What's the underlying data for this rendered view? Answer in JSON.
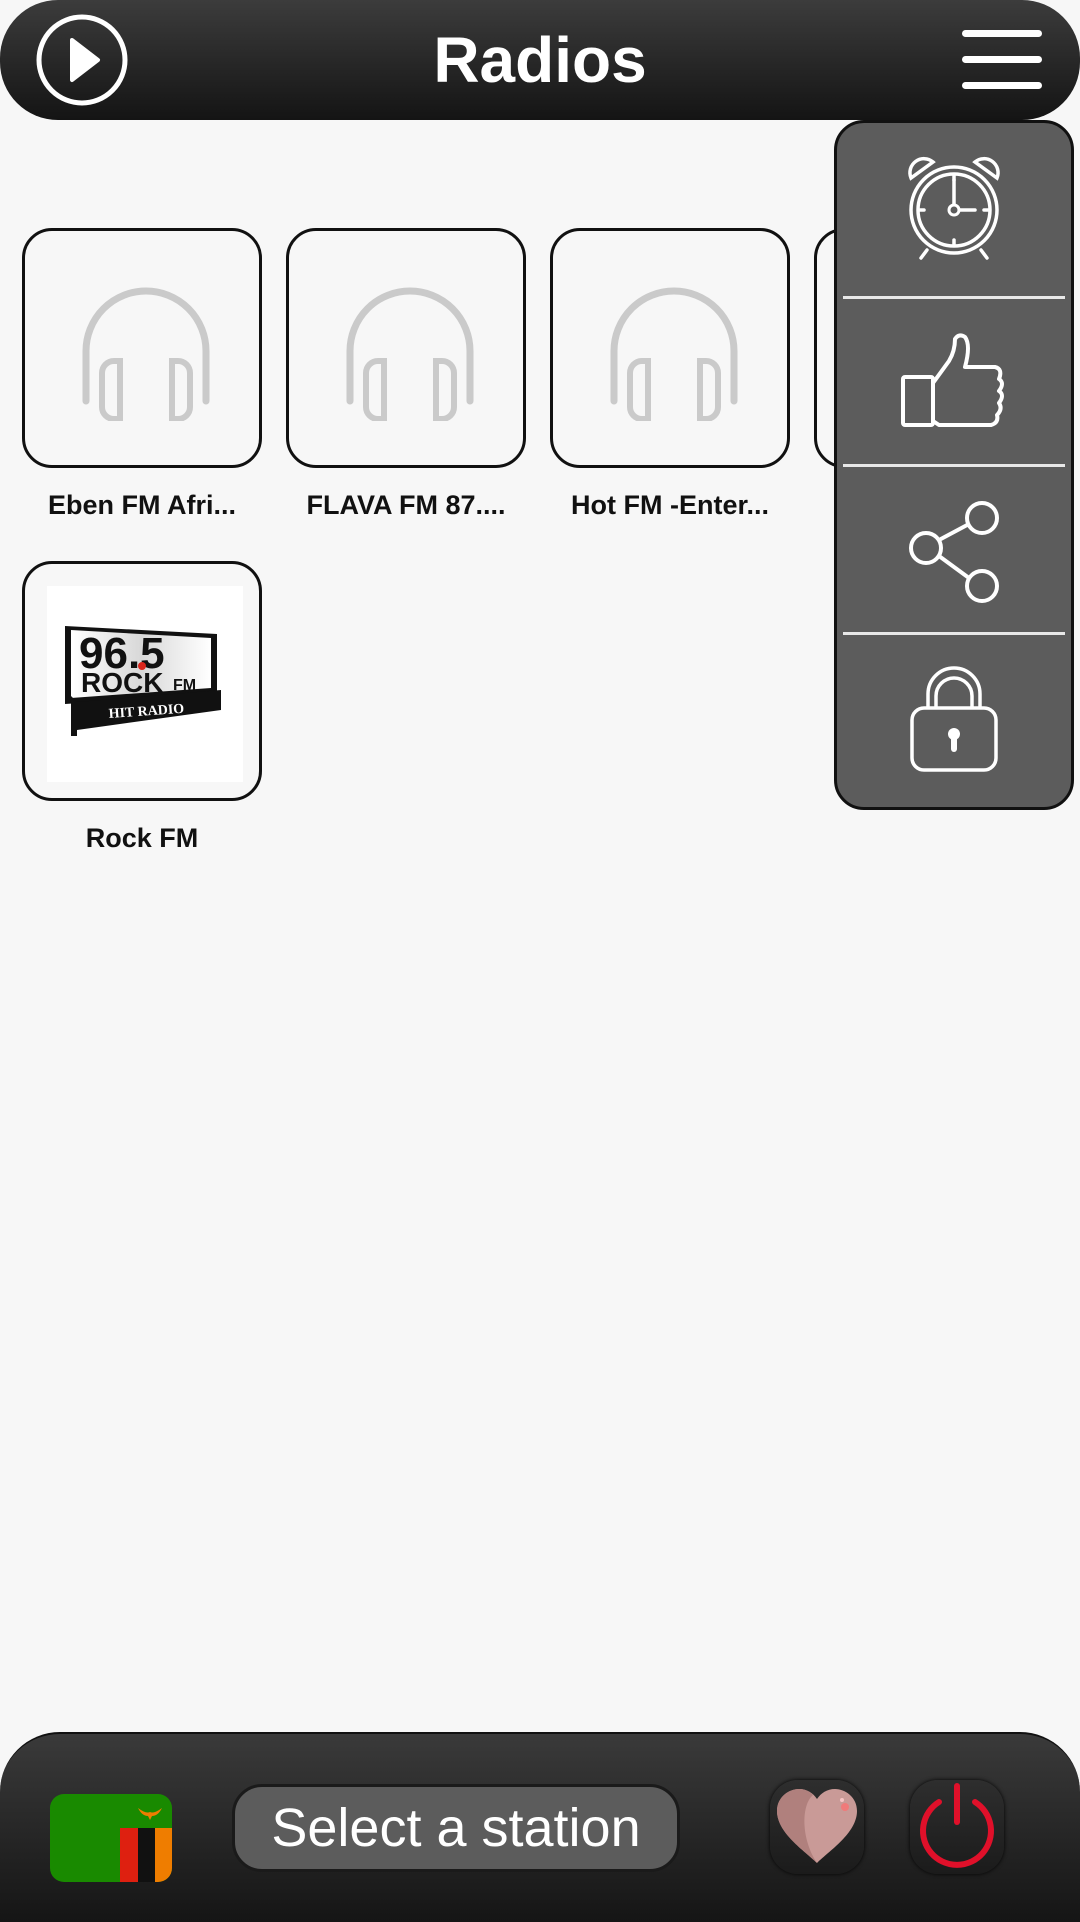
{
  "header": {
    "title": "Radios",
    "play_icon": "play-circle-icon",
    "menu_icon": "hamburger-menu-icon"
  },
  "stations": [
    {
      "name": "Eben FM Afri...",
      "image": "headphones-placeholder"
    },
    {
      "name": "FLAVA FM 87....",
      "image": "headphones-placeholder"
    },
    {
      "name": "Hot FM -Enter...",
      "image": "headphones-placeholder"
    },
    {
      "name": "Rock FM",
      "image": "rock-fm-logo",
      "logo": {
        "line1": "96.5",
        "line2": "ROCK",
        "line2_suffix": "FM",
        "band": "HIT RADIO"
      }
    }
  ],
  "side_menu": {
    "items": [
      {
        "id": "alarm",
        "icon": "alarm-clock-icon"
      },
      {
        "id": "rate",
        "icon": "thumbs-up-icon"
      },
      {
        "id": "share",
        "icon": "share-icon"
      },
      {
        "id": "privacy",
        "icon": "lock-icon"
      }
    ]
  },
  "bottom_bar": {
    "country_flag": "zambia-flag-icon",
    "station_label": "Select a station",
    "favorite_icon": "heart-icon",
    "power_icon": "power-icon"
  },
  "colors": {
    "bar_dark": "#151515",
    "menu_gray": "#5c5c5c",
    "power_red": "#e0102a",
    "heart_pink": "#c99a97",
    "background": "#f7f7f7"
  }
}
